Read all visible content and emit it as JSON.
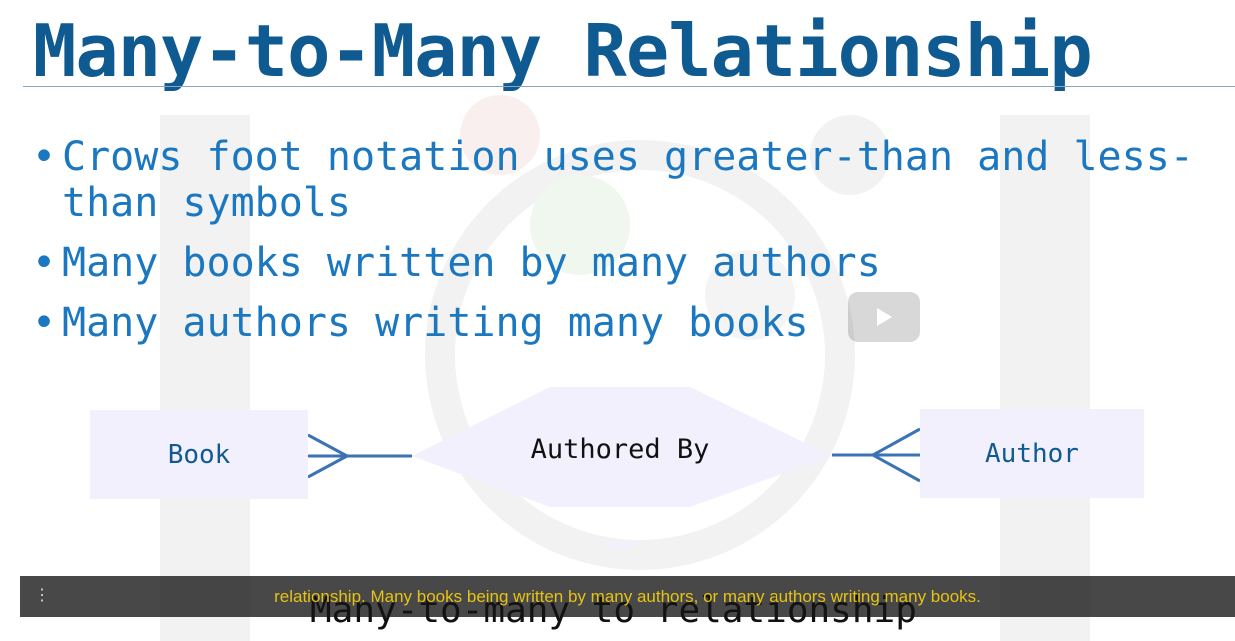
{
  "slide": {
    "title": "Many-to-Many Relationship",
    "bullets": [
      "Crows foot notation uses greater-than and less-than symbols",
      "Many books written by many authors",
      "Many authors writing many books"
    ]
  },
  "diagram": {
    "entity_left": "Book",
    "relationship": "Authored By",
    "entity_right": "Author"
  },
  "slide_caption": "Many-to-many to relationship",
  "player": {
    "play_icon": "play-icon",
    "menu_icon": "more-vert-icon",
    "subtitle": "relationship. Many books being written by many authors, or many authors writing many books."
  },
  "colors": {
    "title": "#0f5a91",
    "bullet_text": "#1a77c0",
    "entity_fill": "#f3f0fd",
    "relationship_fill": "#f3f0fd",
    "connector": "#3b73b4",
    "subtitle_text": "#e6c313"
  }
}
